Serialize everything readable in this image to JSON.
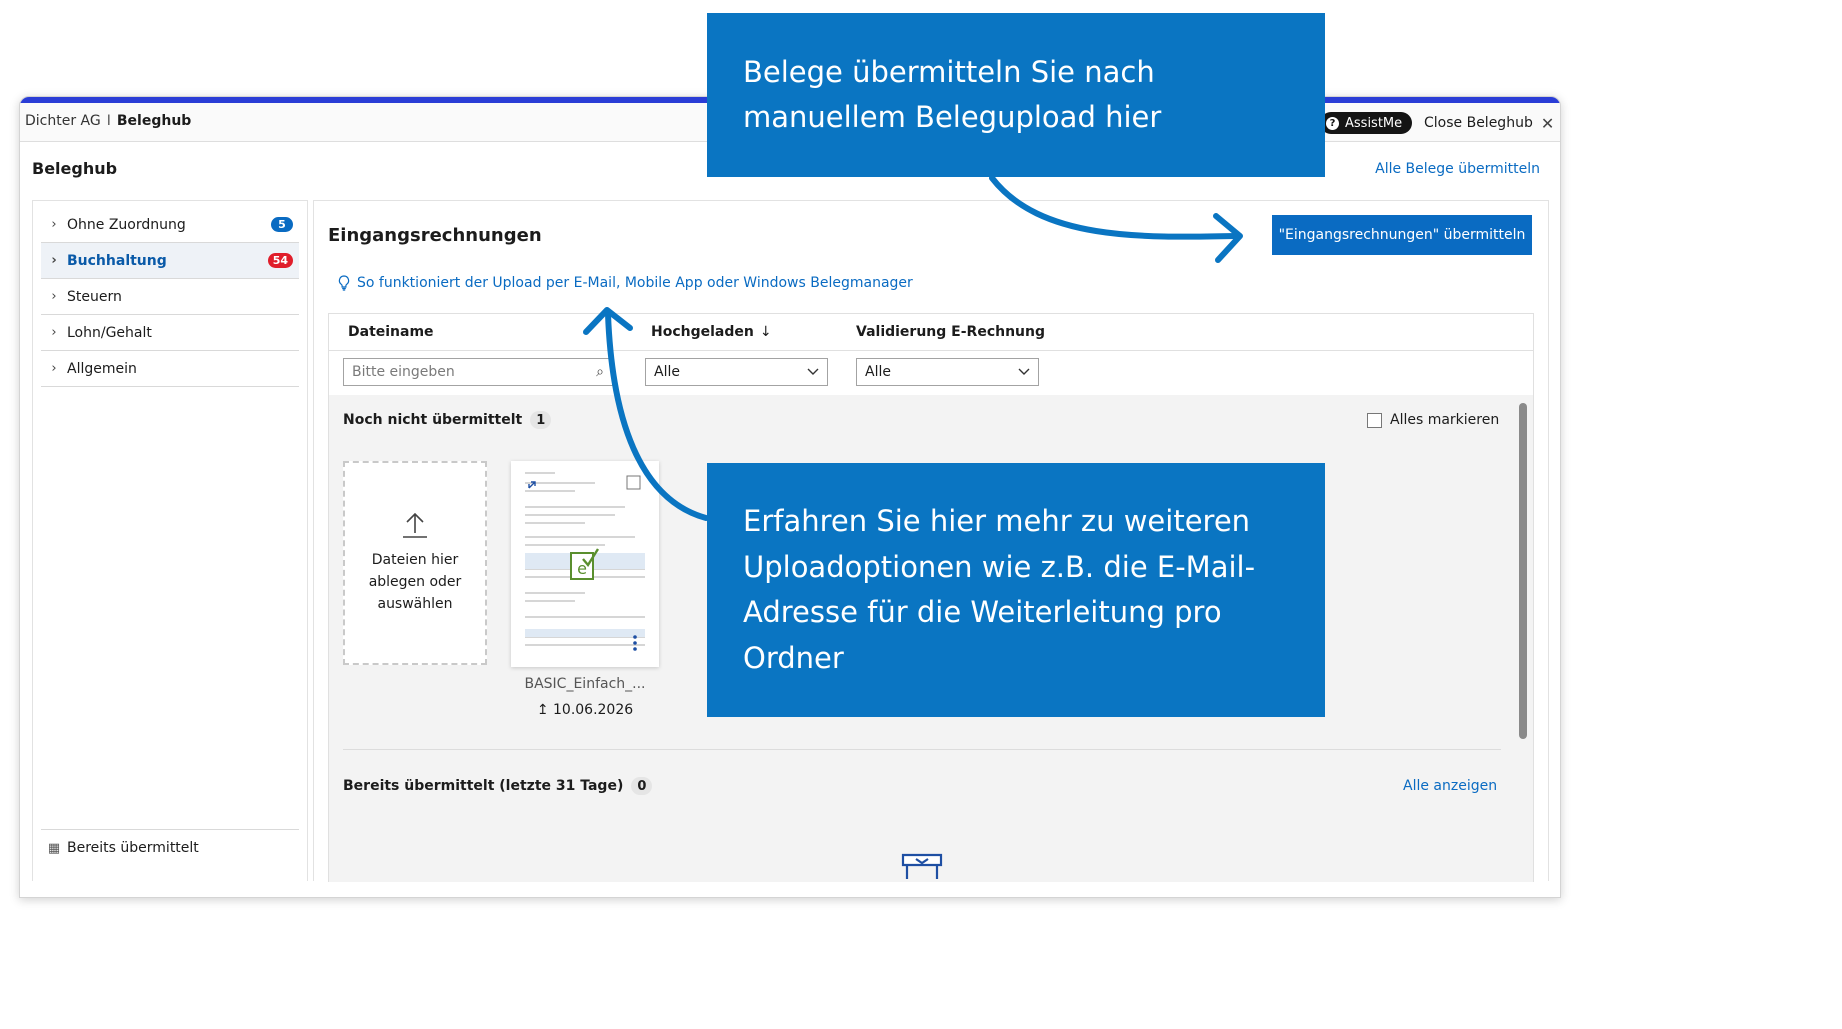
{
  "colors": {
    "accent_bar": "#2a3dd6",
    "primary": "#0a6bc2",
    "callout": "#0a75c2",
    "badge_blue": "#0a6bc2",
    "badge_red": "#e01e2b"
  },
  "header": {
    "company": "Dichter AG",
    "separator": "I",
    "app": "Beleghub",
    "assist_label": "AssistMe",
    "close_label": "Close Beleghub",
    "icons": {
      "assist": "question-icon",
      "close": "close-icon"
    }
  },
  "page": {
    "title": "Beleghub",
    "submit_all_link": "Alle Belege übermitteln"
  },
  "sidebar": {
    "items": [
      {
        "label": "Ohne Zuordnung",
        "badge": "5",
        "badge_color": "#0a6bc2",
        "active": false
      },
      {
        "label": "Buchhaltung",
        "badge": "54",
        "badge_color": "#e01e2b",
        "active": true
      },
      {
        "label": "Steuern",
        "badge": "",
        "active": false
      },
      {
        "label": "Lohn/Gehalt",
        "badge": "",
        "active": false
      },
      {
        "label": "Allgemein",
        "badge": "",
        "active": false
      }
    ],
    "bottom_label": "Bereits übermittelt",
    "icons": {
      "item": "chevron-right-icon",
      "bottom": "table-icon"
    }
  },
  "main": {
    "section_title": "Eingangsrechnungen",
    "submit_button": "\"Eingangsrechnungen\" übermitteln",
    "help_link": "So funktioniert der Upload per E-Mail, Mobile App oder Windows Belegmanager",
    "table": {
      "columns": [
        "Dateiname",
        "Hochgeladen",
        "Validierung E-Rechnung"
      ],
      "sort_icon": "arrow-down-icon",
      "filters": {
        "filename_placeholder": "Bitte eingeben",
        "uploaded_value": "Alle",
        "validation_value": "Alle"
      }
    },
    "pending": {
      "title": "Noch nicht übermittelt",
      "count": "1",
      "mark_all": "Alles markieren",
      "dropzone_text": "Dateien hier ablegen oder auswählen",
      "documents": [
        {
          "name": "BASIC_Einfach_...",
          "date": "10.06.2026",
          "icon": "e-invoice-check-icon"
        }
      ]
    },
    "submitted": {
      "title": "Bereits übermittelt (letzte 31 Tage)",
      "count": "0",
      "show_all": "Alle anzeigen"
    }
  },
  "callouts": {
    "top": "Belege übermitteln Sie nach manuellem Belegupload hier",
    "bottom": "Erfahren Sie hier mehr zu weiteren Uploadoptionen wie z.B. die E-Mail-Adresse für die Weiterleitung pro Ordner"
  }
}
